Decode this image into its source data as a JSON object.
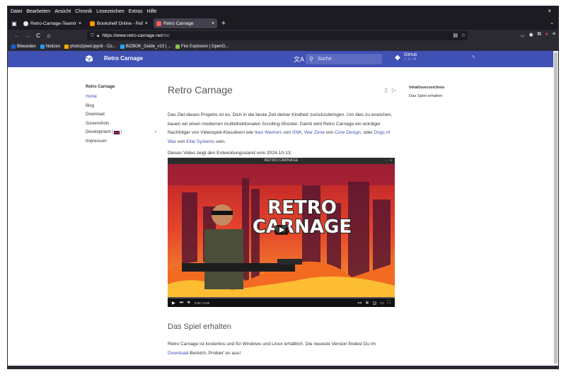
{
  "menu": [
    "Datei",
    "Bearbeiten",
    "Ansicht",
    "Chronik",
    "Lesezeichen",
    "Extras",
    "Hilfe"
  ],
  "window_close": "×",
  "tabs": [
    {
      "title": "Retro-Carnage-Team/re",
      "close": "×",
      "favicon_color": "#e6e6e6"
    },
    {
      "title": "Bookshelf Online - Ref: C",
      "close": "×",
      "favicon_color": "#ff9400"
    },
    {
      "title": "Retro Carnage",
      "close": "×",
      "favicon_color": "#ff5c5c"
    }
  ],
  "newtab": "+",
  "tab_overflow": "⌄",
  "nav": {
    "back": "←",
    "forward": "→",
    "reload": "C",
    "home": "⌂"
  },
  "url": {
    "host": "https://www.retro-carnage.net",
    "path": "/de/"
  },
  "bookmarks": [
    {
      "label": "Bitwarden",
      "color": "#175ddc"
    },
    {
      "label": "Notizen",
      "color": "#2196f3"
    },
    {
      "label": "photo2pixel.ipynb - Co...",
      "color": "#f9ab00"
    },
    {
      "label": "BIZBOK_Guide_v13 | ...",
      "color": "#1ea7fd"
    },
    {
      "label": "Fire Explosion | OpenG...",
      "color": "#8bc34a"
    }
  ],
  "header": {
    "site_title": "Retro Carnage",
    "search_placeholder": "Suche",
    "github_label": "GitHub",
    "github_stats": "☆ 1   ⑂ 0",
    "brand_color": "#3f51b5"
  },
  "leftnav": {
    "title": "Retro Carnage",
    "items": [
      "Home",
      "Blog",
      "Download",
      "Screenshots",
      "Development (",
      "Impressum"
    ],
    "development_suffix": ")",
    "chevron": "›"
  },
  "main": {
    "title": "Retro Carnage",
    "intro_parts": [
      "Das Ziel dieses Projekts ist es, Dich in die beste Zeit deiner Kindheit zurückzubringen. Um dies zu erreichen, bauen wir einen modernen multidirektionalen Scrolling-Shooter. Damit wird Retro Carnage ein würdiger Nachfolger von Videospiel-Klassikern wie ",
      "Ikari Warriors",
      " von ",
      "SNK",
      ", ",
      "War Zone",
      " von ",
      "Core Design",
      ", oder ",
      "Dogs of War",
      " von ",
      "Elite Systems",
      " sein."
    ],
    "video_intro": "Dieses Video zeigt den Entwicklungsstand vom 2024-10-13:",
    "video_title": "RETRO CARNAGE",
    "video_logo_line1": "RETRO",
    "video_logo_line2": "CARNAGE",
    "video_time": "0:00 / 0:00",
    "section_title": "Das Spiel erhalten",
    "getgame_before": "Retro Carnage ist kostenlos und für Windows und Linux erhältlich. Die neueste Version findest Du im ",
    "getgame_link": "Download",
    "getgame_after": "-Bereich. Probier' es aus!"
  },
  "toc": {
    "title": "Inhaltsverzeichnis",
    "items": [
      "Das Spiel erhalten"
    ]
  }
}
